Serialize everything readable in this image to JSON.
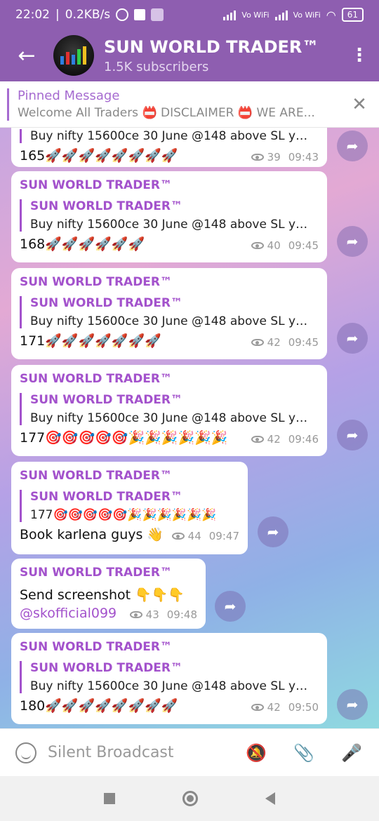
{
  "status": {
    "time": "22:02",
    "speed": "0.2KB/s",
    "vo1": "Vo WiFi",
    "vo2": "Vo WiFi",
    "battery": "61"
  },
  "header": {
    "title": "SUN WORLD TRADER™",
    "subtitle": "1.5K subscribers"
  },
  "pinned": {
    "title": "Pinned Message",
    "text": "Welcome All Traders 📛 DISCLAIMER 📛 WE ARE..."
  },
  "messages": [
    {
      "quote_text": "Buy nifty 15600ce 30 June @148 above SL yo...",
      "body": "165🚀🚀🚀🚀🚀🚀🚀🚀",
      "views": "39",
      "time": "09:43"
    },
    {
      "sender": "SUN WORLD TRADER™",
      "quote_name": "SUN WORLD TRADER™",
      "quote_text": "Buy nifty 15600ce 30 June @148 above SL yo...",
      "body": "168🚀🚀🚀🚀🚀🚀",
      "views": "40",
      "time": "09:45"
    },
    {
      "sender": "SUN WORLD TRADER™",
      "quote_name": "SUN WORLD TRADER™",
      "quote_text": "Buy nifty 15600ce 30 June @148 above SL yo...",
      "body": "171🚀🚀🚀🚀🚀🚀🚀",
      "views": "42",
      "time": "09:45"
    },
    {
      "sender": "SUN WORLD TRADER™",
      "quote_name": "SUN WORLD TRADER™",
      "quote_text": "Buy nifty 15600ce 30 June @148 above SL yo...",
      "body": "177🎯🎯🎯🎯🎯🎉🎉🎉🎉🎉🎉",
      "views": "42",
      "time": "09:46"
    },
    {
      "sender": "SUN WORLD TRADER™",
      "quote_name": "SUN WORLD TRADER™",
      "quote_text": "177🎯🎯🎯🎯🎯🎉🎉🎉🎉🎉🎉",
      "body": "Book karlena guys 👋",
      "views": "44",
      "time": "09:47"
    },
    {
      "sender": "SUN WORLD TRADER™",
      "line1": "Send screenshot 👇👇👇",
      "link": "@skofficial099",
      "views": "43",
      "time": "09:48"
    },
    {
      "sender": "SUN WORLD TRADER™",
      "quote_name": "SUN WORLD TRADER™",
      "quote_text": "Buy nifty 15600ce 30 June @148 above SL yo...",
      "body": "180🚀🚀🚀🚀🚀🚀🚀🚀",
      "views": "42",
      "time": "09:50"
    }
  ],
  "bottom": {
    "placeholder": "Silent Broadcast"
  },
  "colors": {
    "accent": "#8e5eb0",
    "sender": "#a352cc"
  }
}
